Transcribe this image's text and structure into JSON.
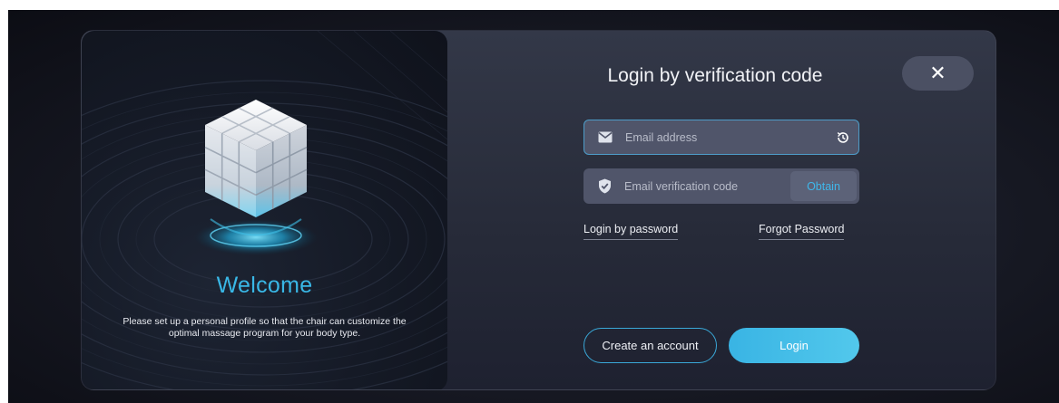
{
  "welcome": {
    "title": "Welcome",
    "subtitle_line1": "Please set up a personal profile so that the chair can customize the",
    "subtitle_line2": "optimal massage program for your body type."
  },
  "login": {
    "title": "Login by verification code",
    "close_symbol": "✕",
    "email_placeholder": "Email address",
    "code_placeholder": "Email verification code",
    "obtain_label": "Obtain",
    "login_by_password": "Login by password",
    "forgot_password": "Forgot Password",
    "create_account": "Create an account",
    "login_button": "Login"
  },
  "icons": {
    "email": "envelope-icon",
    "code": "shield-check-icon",
    "history": "history-icon",
    "close": "close-icon",
    "illustration": "cube-illustration"
  },
  "colors": {
    "accent": "#39b7e6",
    "field_bg": "#50556a",
    "dialog_bg": "#2d3242"
  }
}
